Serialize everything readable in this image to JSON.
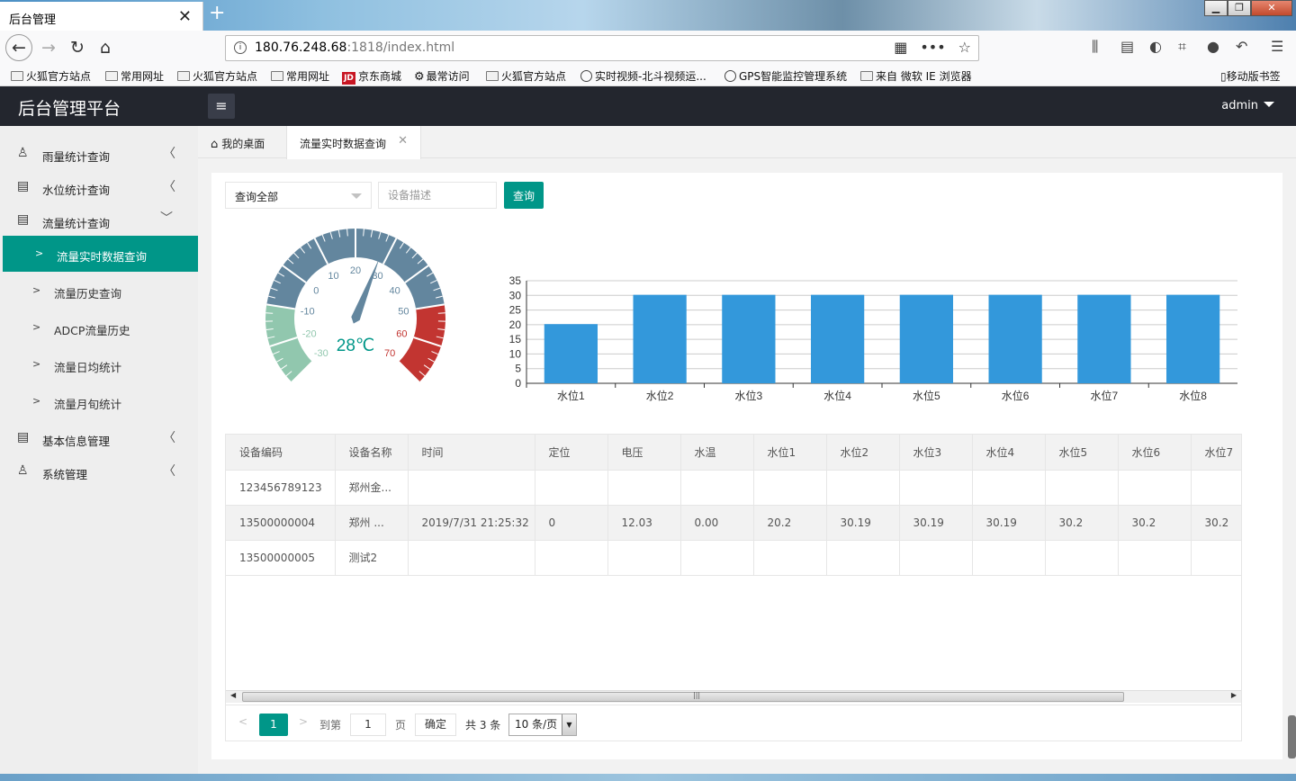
{
  "browser": {
    "tab_title": "后台管理",
    "tab_close": "✕",
    "new_tab": "+",
    "url_host": "180.76.248.68",
    "url_rest": ":1818/index.html",
    "bookmarks": [
      "火狐官方站点",
      "常用网址",
      "火狐官方站点",
      "常用网址",
      "京东商城",
      "最常访问",
      "火狐官方站点",
      "实时视频-北斗视频运...",
      "GPS智能监控管理系统",
      "来自 微软 IE 浏览器"
    ],
    "jd_badge": "JD",
    "mobile_bookmarks": "移动版书签"
  },
  "header": {
    "title": "后台管理平台",
    "menu_icon": "≡",
    "user": "admin"
  },
  "sidebar": {
    "groups": [
      {
        "label": "雨量统计查询",
        "icon": "user-icon"
      },
      {
        "label": "水位统计查询",
        "icon": "doc-icon"
      },
      {
        "label": "流量统计查询",
        "icon": "doc-icon"
      },
      {
        "label": "基本信息管理",
        "icon": "doc-icon"
      },
      {
        "label": "系统管理",
        "icon": "user-icon"
      }
    ],
    "subitems": [
      "流量实时数据查询",
      "流量历史查询",
      "ADCP流量历史",
      "流量日均统计",
      "流量月旬统计"
    ],
    "active_sub": "流量实时数据查询"
  },
  "page_tabs": {
    "home": "我的桌面",
    "current": "流量实时数据查询",
    "close": "✕"
  },
  "toolbar": {
    "select_value": "查询全部",
    "desc_placeholder": "设备描述",
    "query_label": "查询"
  },
  "gauge": {
    "value": 28,
    "unit": "℃",
    "display": "28℃",
    "min": -30,
    "max": 70,
    "ticks": [
      "-30",
      "-20",
      "-10",
      "0",
      "10",
      "20",
      "30",
      "40",
      "50",
      "60",
      "70"
    ],
    "colors": {
      "low": "#91c7ae",
      "mid": "#63869e",
      "high": "#c23531",
      "text": "#009688"
    }
  },
  "chart_data": {
    "type": "bar",
    "categories": [
      "水位1",
      "水位2",
      "水位3",
      "水位4",
      "水位5",
      "水位6",
      "水位7",
      "水位8"
    ],
    "values": [
      20.2,
      30.19,
      30.19,
      30.19,
      30.2,
      30.2,
      30.2,
      30.2
    ],
    "ylim": [
      0,
      35
    ],
    "yticks": [
      "0",
      "5",
      "10",
      "15",
      "20",
      "25",
      "30",
      "35"
    ],
    "color": "#3398db",
    "grid": true
  },
  "table": {
    "headers": [
      "设备编码",
      "设备名称",
      "时间",
      "定位",
      "电压",
      "水温",
      "水位1",
      "水位2",
      "水位3",
      "水位4",
      "水位5",
      "水位6",
      "水位7"
    ],
    "rows": [
      [
        "123456789123",
        "郑州金...",
        "",
        "",
        "",
        "",
        "",
        "",
        "",
        "",
        "",
        "",
        ""
      ],
      [
        "13500000004",
        "郑州 ...",
        "2019/7/31 21:25:32",
        "0",
        "12.03",
        "0.00",
        "20.2",
        "30.19",
        "30.19",
        "30.19",
        "30.2",
        "30.2",
        "30.2"
      ],
      [
        "13500000005",
        "测试2",
        "",
        "",
        "",
        "",
        "",
        "",
        "",
        "",
        "",
        "",
        ""
      ]
    ]
  },
  "pager": {
    "prev": "<",
    "current": "1",
    "next": ">",
    "goto_label": "到第",
    "goto_value": "1",
    "unit": "页",
    "confirm": "确定",
    "total": "共 3 条",
    "page_size": "10 条/页"
  }
}
